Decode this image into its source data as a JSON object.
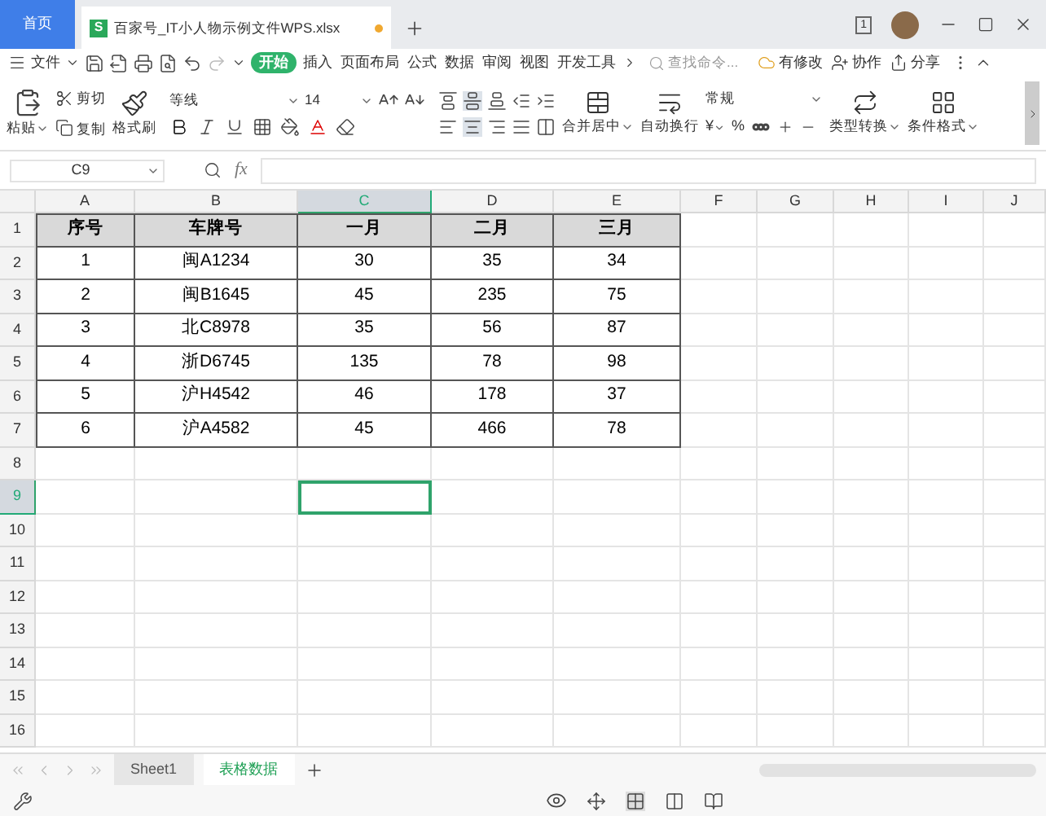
{
  "title_bar": {
    "home_tab": "首页",
    "document_tab": {
      "icon_letter": "S",
      "title": "百家号_IT小人物示例文件WPS.xlsx",
      "modified": true
    },
    "page_badge": "1"
  },
  "menu_bar": {
    "file_menu": "文件",
    "tabs": [
      {
        "label": "开始",
        "selected": true
      },
      {
        "label": "插入",
        "selected": false
      },
      {
        "label": "页面布局",
        "selected": false
      },
      {
        "label": "公式",
        "selected": false
      },
      {
        "label": "数据",
        "selected": false
      },
      {
        "label": "审阅",
        "selected": false
      },
      {
        "label": "视图",
        "selected": false
      },
      {
        "label": "开发工具",
        "selected": false
      }
    ],
    "search": {
      "placeholder": "查找命令..."
    },
    "actions": [
      "有修改",
      "协作",
      "分享"
    ]
  },
  "ribbon": {
    "paste": "粘贴",
    "cut": "剪切",
    "copy": "复制",
    "format_painter": "格式刷",
    "font": "等线",
    "font_size": "14",
    "merge": "合并居中",
    "wrap": "自动换行",
    "number_format": "常规",
    "currency": "¥",
    "percent": "%",
    "convert": "类型转换",
    "conditional_format": "条件格式"
  },
  "formula_bar": {
    "name_box": "C9",
    "fx": "fx"
  },
  "grid": {
    "columns": [
      {
        "label": "A",
        "selected": false
      },
      {
        "label": "B",
        "selected": false
      },
      {
        "label": "C",
        "selected": true
      },
      {
        "label": "D",
        "selected": false
      },
      {
        "label": "E",
        "selected": false
      },
      {
        "label": "F",
        "selected": false
      },
      {
        "label": "G",
        "selected": false
      },
      {
        "label": "H",
        "selected": false
      },
      {
        "label": "I",
        "selected": false
      },
      {
        "label": "J",
        "selected": false
      }
    ],
    "rows": [
      {
        "label": "1",
        "selected": false
      },
      {
        "label": "2",
        "selected": false
      },
      {
        "label": "3",
        "selected": false
      },
      {
        "label": "4",
        "selected": false
      },
      {
        "label": "5",
        "selected": false
      },
      {
        "label": "6",
        "selected": false
      },
      {
        "label": "7",
        "selected": false
      },
      {
        "label": "8",
        "selected": false
      },
      {
        "label": "9",
        "selected": true
      },
      {
        "label": "10",
        "selected": false
      },
      {
        "label": "11",
        "selected": false
      },
      {
        "label": "12",
        "selected": false
      },
      {
        "label": "13",
        "selected": false
      },
      {
        "label": "14",
        "selected": false
      },
      {
        "label": "15",
        "selected": false
      },
      {
        "label": "16",
        "selected": false
      }
    ],
    "table": {
      "header": [
        "序号",
        "车牌号",
        "一月",
        "二月",
        "三月"
      ],
      "rows": [
        [
          "1",
          "闽A1234",
          "30",
          "35",
          "34"
        ],
        [
          "2",
          "闽B1645",
          "45",
          "235",
          "75"
        ],
        [
          "3",
          "北C8978",
          "35",
          "56",
          "87"
        ],
        [
          "4",
          "浙D6745",
          "135",
          "78",
          "98"
        ],
        [
          "5",
          "沪H4542",
          "46",
          "178",
          "37"
        ],
        [
          "6",
          "沪A4582",
          "45",
          "466",
          "78"
        ]
      ]
    }
  },
  "sheet_tabs": [
    {
      "label": "Sheet1",
      "selected": false
    },
    {
      "label": "表格数据",
      "selected": true
    }
  ]
}
